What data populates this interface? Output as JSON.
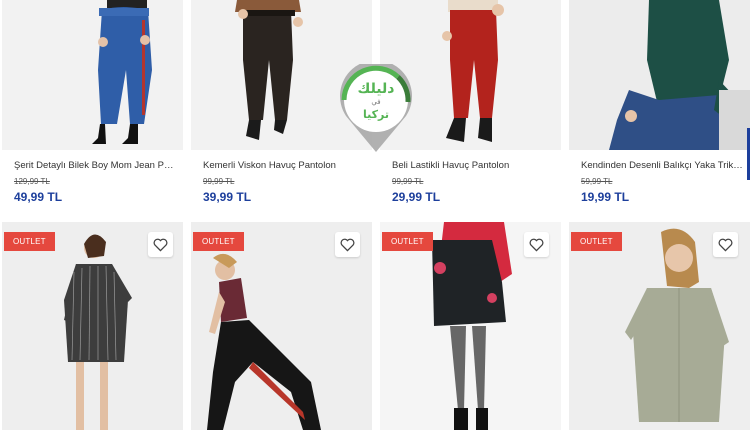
{
  "products_top": [
    {
      "name": "Şerit Detaylı Bilek Boy Mom Jean Pa...",
      "old_price": "129,99 TL",
      "new_price": "49,99 TL"
    },
    {
      "name": "Kemerli Viskon Havuç Pantolon",
      "old_price": "99,99 TL",
      "new_price": "39,99 TL"
    },
    {
      "name": "Beli Lastikli Havuç Pantolon",
      "old_price": "99,99 TL",
      "new_price": "29,99 TL"
    },
    {
      "name": "Kendinden Desenli Balıkçı Yaka Triko...",
      "old_price": "59,99 TL",
      "new_price": "19,99 TL"
    }
  ],
  "products_bottom": [
    {
      "badge": "OUTLET"
    },
    {
      "badge": "OUTLET"
    },
    {
      "badge": "OUTLET"
    },
    {
      "badge": "OUTLET"
    }
  ],
  "watermark": {
    "text_top": "دليلك",
    "text_mid": "في",
    "text_bottom": "تركيا"
  },
  "colors": {
    "price": "#1d3f9c",
    "badge": "#e5483e",
    "logo_green": "#4caf50"
  }
}
